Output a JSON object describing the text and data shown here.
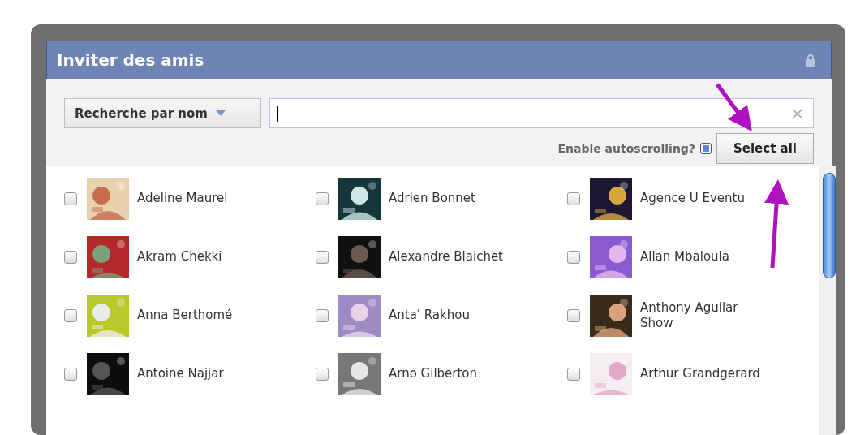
{
  "dialog": {
    "title": "Inviter des amis"
  },
  "search": {
    "filter": "Recherche par nom",
    "clear": "×"
  },
  "autoscroll": {
    "label": "Enable autoscrolling?",
    "checked": true
  },
  "select_all": "Select all",
  "friends": [
    {
      "name": "Adeline Maurel",
      "checked": false
    },
    {
      "name": "Adrien Bonnet",
      "checked": false
    },
    {
      "name": "Agence U Eventu",
      "checked": false
    },
    {
      "name": "Akram Chekki",
      "checked": false
    },
    {
      "name": "Alexandre Blaichet",
      "checked": false
    },
    {
      "name": "Allan Mbaloula",
      "checked": false
    },
    {
      "name": "Anna Berthomé",
      "checked": false
    },
    {
      "name": "Anta' Rakhou",
      "checked": false
    },
    {
      "name": "Anthony Aguilar Show",
      "checked": false
    },
    {
      "name": "Antoine Najjar",
      "checked": false
    },
    {
      "name": "Arno Gilberton",
      "checked": false
    },
    {
      "name": "Arthur Grandgerard",
      "checked": false
    }
  ]
}
